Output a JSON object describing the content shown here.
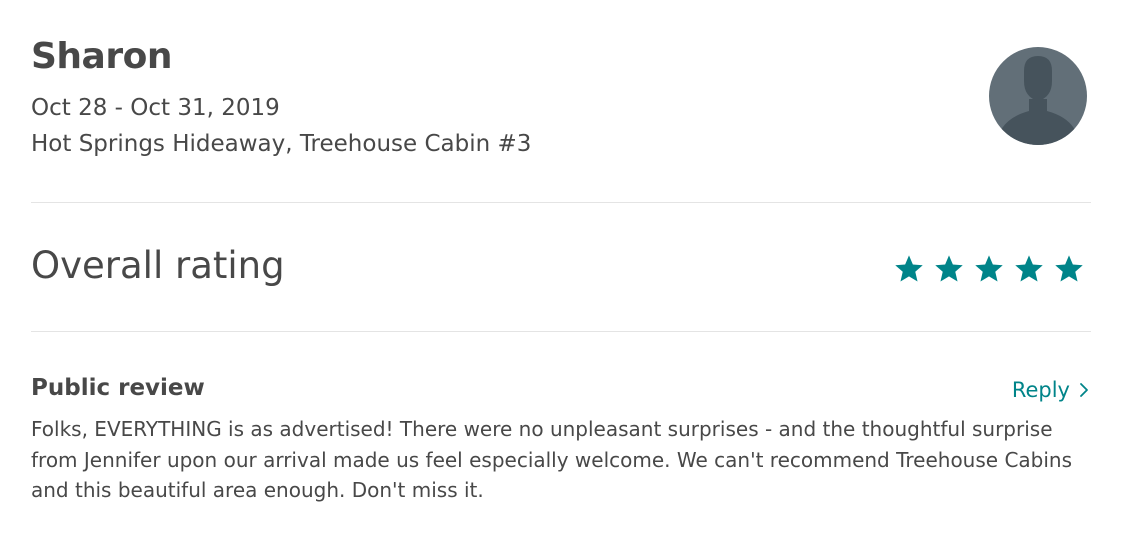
{
  "guest": {
    "name": "Sharon",
    "dates": "Oct 28 - Oct 31, 2019",
    "listing": "Hot Springs Hideaway, Treehouse Cabin #3",
    "avatar_icon": "default-user-avatar-icon"
  },
  "rating": {
    "label": "Overall rating",
    "stars": 5,
    "max_stars": 5,
    "star_color": "#008489",
    "star_icon": "star-icon"
  },
  "review": {
    "heading": "Public review",
    "reply_label": "Reply",
    "reply_icon": "chevron-right-icon",
    "text": "Folks, EVERYTHING is as advertised! There were no unpleasant surprises - and the thoughtful surprise from Jennifer upon our arrival made us feel especially welcome. We can't recommend Treehouse Cabins and this beautiful area enough. Don't miss it."
  },
  "colors": {
    "text": "#484848",
    "accent": "#008489",
    "divider": "#e4e4e4",
    "avatar_bg": "#626f78",
    "avatar_fg": "#46535c"
  }
}
